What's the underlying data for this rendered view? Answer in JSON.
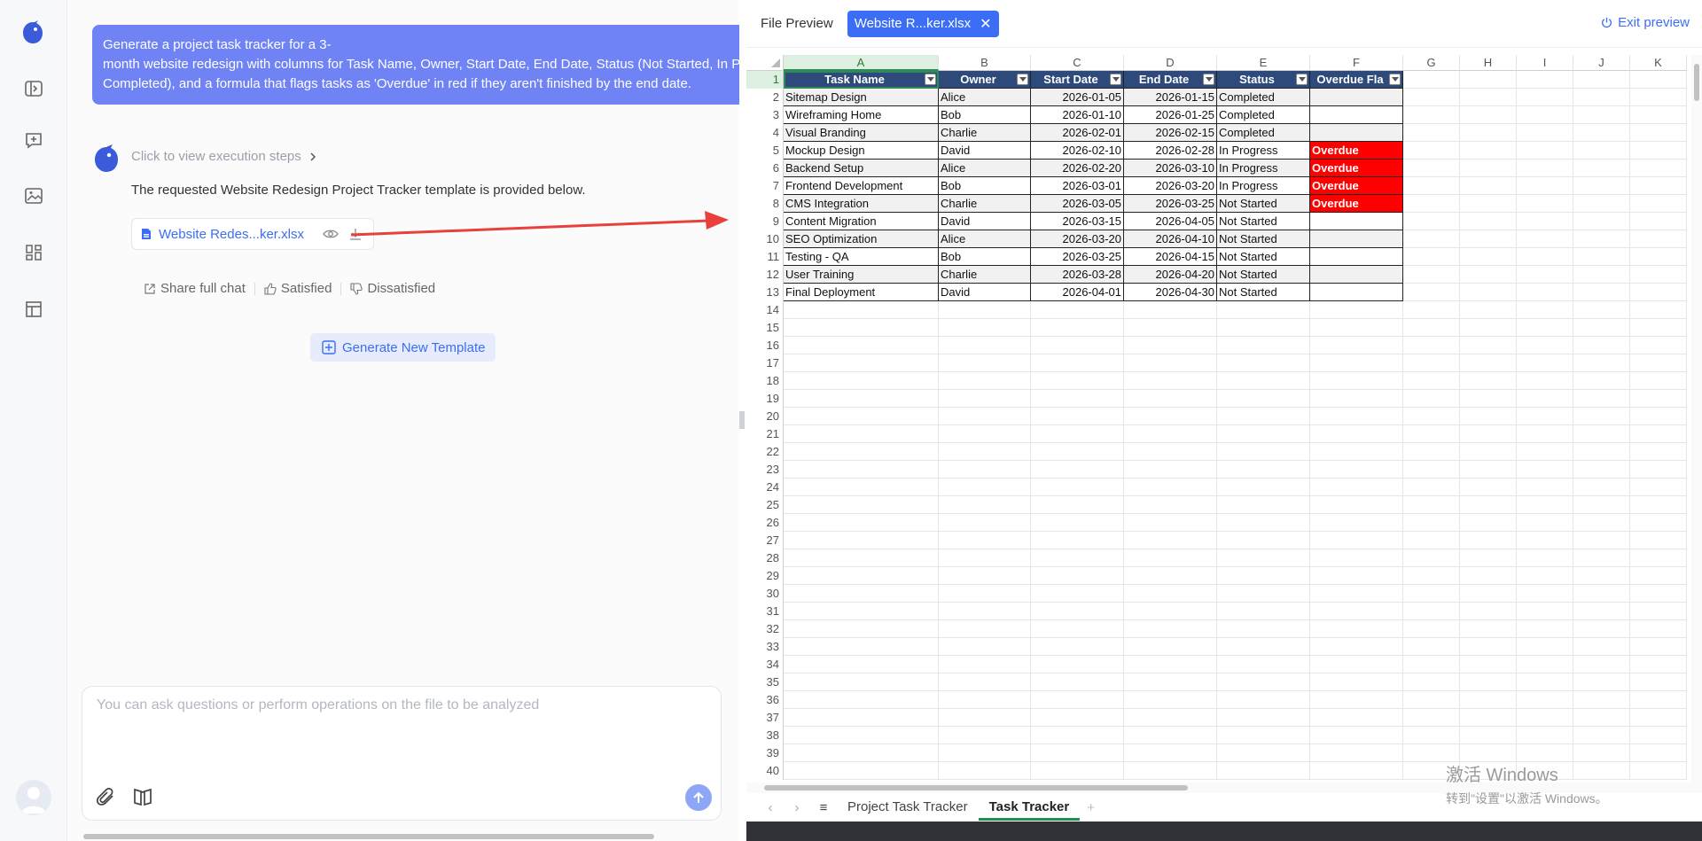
{
  "chat": {
    "user_message_line1": "Generate a project task tracker for a 3-",
    "user_message_line2": "month website redesign with columns for Task Name, Owner, Start Date, End Date, Status (Not Started, In Progress,",
    "user_message_line3": "Completed), and a formula that flags tasks as 'Overdue' in red if they aren't finished by the end date.",
    "execution_steps": "Click to view execution steps",
    "reply": "The requested Website Redesign Project Tracker template is provided below.",
    "file_name": "Website Redes...ker.xlsx",
    "share": "Share full chat",
    "satisfied": "Satisfied",
    "dissatisfied": "Dissatisfied",
    "generate_new": "Generate New Template",
    "input_placeholder": "You can ask questions or perform operations on the file to be analyzed"
  },
  "preview": {
    "title": "File Preview",
    "tab_label": "Website R...ker.xlsx",
    "exit": "Exit preview"
  },
  "sheet": {
    "columns": [
      "A",
      "B",
      "C",
      "D",
      "E",
      "F",
      "G",
      "H",
      "I",
      "J",
      "K"
    ],
    "headers": [
      "Task Name",
      "Owner",
      "Start Date",
      "End Date",
      "Status",
      "Overdue Fla"
    ],
    "rows": [
      [
        "Sitemap Design",
        "Alice",
        "2026-01-05",
        "2026-01-15",
        "Completed",
        ""
      ],
      [
        "Wireframing Home",
        "Bob",
        "2026-01-10",
        "2026-01-25",
        "Completed",
        ""
      ],
      [
        "Visual Branding",
        "Charlie",
        "2026-02-01",
        "2026-02-15",
        "Completed",
        ""
      ],
      [
        "Mockup Design",
        "David",
        "2026-02-10",
        "2026-02-28",
        "In Progress",
        "Overdue"
      ],
      [
        "Backend Setup",
        "Alice",
        "2026-02-20",
        "2026-03-10",
        "In Progress",
        "Overdue"
      ],
      [
        "Frontend Development",
        "Bob",
        "2026-03-01",
        "2026-03-20",
        "In Progress",
        "Overdue"
      ],
      [
        "CMS Integration",
        "Charlie",
        "2026-03-05",
        "2026-03-25",
        "Not Started",
        "Overdue"
      ],
      [
        "Content Migration",
        "David",
        "2026-03-15",
        "2026-04-05",
        "Not Started",
        ""
      ],
      [
        "SEO Optimization",
        "Alice",
        "2026-03-20",
        "2026-04-10",
        "Not Started",
        ""
      ],
      [
        "Testing - QA",
        "Bob",
        "2026-03-25",
        "2026-04-15",
        "Not Started",
        ""
      ],
      [
        "User Training",
        "Charlie",
        "2026-03-28",
        "2026-04-20",
        "Not Started",
        ""
      ],
      [
        "Final Deployment",
        "David",
        "2026-04-01",
        "2026-04-30",
        "Not Started",
        ""
      ]
    ],
    "row_numbers": [
      "1",
      "2",
      "3",
      "4",
      "5",
      "6",
      "7",
      "8",
      "9",
      "10",
      "11",
      "12",
      "13",
      "14",
      "15",
      "16",
      "17",
      "18",
      "19",
      "20",
      "21",
      "22",
      "23",
      "24",
      "25",
      "26",
      "27",
      "28",
      "29",
      "30",
      "31",
      "32",
      "33",
      "34",
      "35",
      "36",
      "37",
      "38",
      "39",
      "40"
    ],
    "tabs": [
      "Project Task Tracker",
      "Task Tracker"
    ],
    "active_tab": "Task Tracker",
    "overdue_color": "#ff0000",
    "header_color": "#2d4a7a"
  },
  "watermark": {
    "line1": "激活 Windows",
    "line2": "转到\"设置\"以激活 Windows。"
  },
  "icons": {
    "rail": [
      "app-logo-icon",
      "sidebar-toggle-icon",
      "new-chat-icon",
      "image-gallery-icon",
      "apps-grid-icon",
      "layout-template-icon",
      "user-avatar-icon"
    ]
  }
}
